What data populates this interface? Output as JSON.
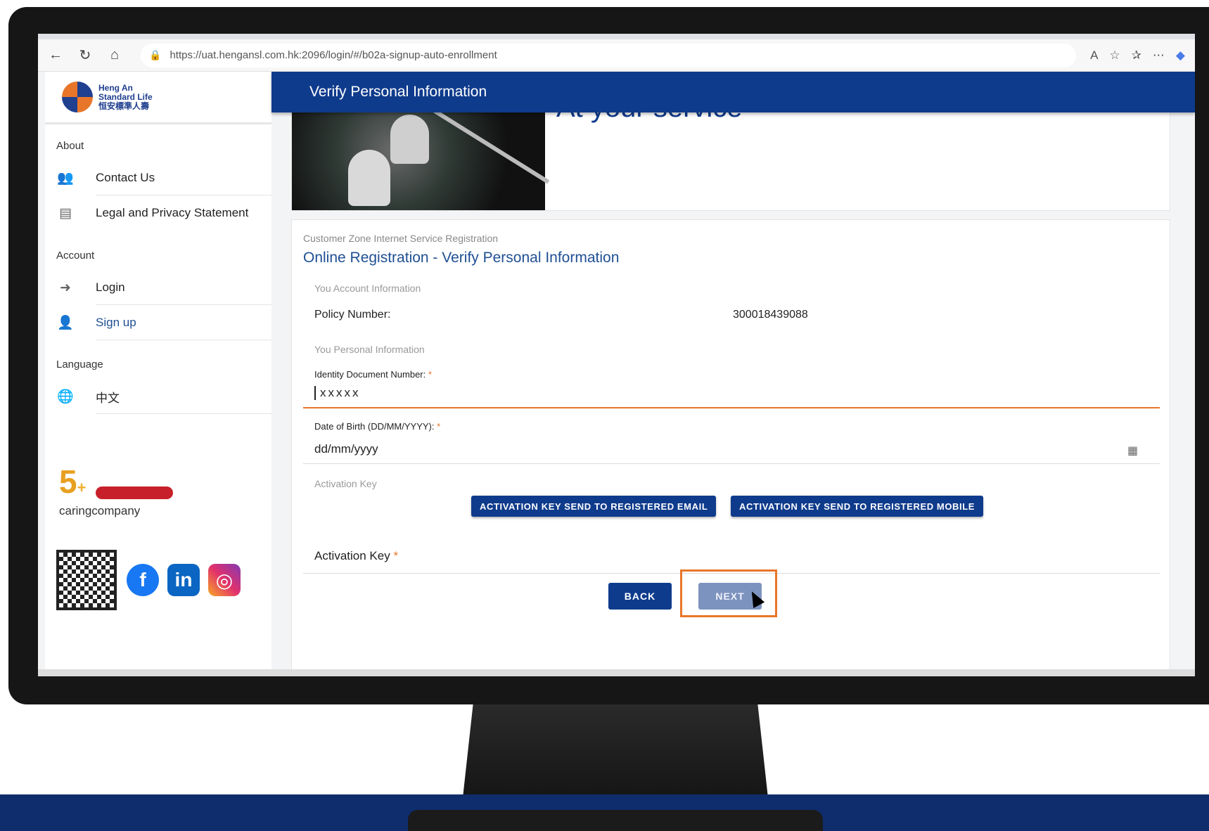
{
  "browser": {
    "url": "https://uat.hengansl.com.hk:2096/login/#/b02a-signup-auto-enrollment"
  },
  "sidebar": {
    "logo_text_line1": "Heng An",
    "logo_text_line2": "Standard Life",
    "logo_text_line3": "恒安標準人壽",
    "sections": {
      "about": "About",
      "account": "Account",
      "language": "Language"
    },
    "items": {
      "contact": "Contact Us",
      "legal": "Legal and Privacy Statement",
      "login": "Login",
      "signup": "Sign up",
      "chinese": "中文"
    },
    "caring_text": "caringcompany"
  },
  "header": {
    "title": "Verify Personal Information"
  },
  "banner": {
    "title": "At your service"
  },
  "form": {
    "breadcrumb": "Customer Zone Internet Service Registration",
    "title": "Online Registration - Verify Personal Information",
    "account_section": "You Account Information",
    "policy_label": "Policy Number:",
    "policy_value": "300018439088",
    "personal_section": "You Personal Information",
    "id_label": "Identity Document Number:",
    "id_value": "xxxxx",
    "dob_label": "Date of Birth (DD/MM/YYYY):",
    "dob_placeholder": "dd/mm/yyyy",
    "activation_section": "Activation Key",
    "email_btn": "ACTIVATION KEY SEND TO REGISTERED EMAIL",
    "mobile_btn": "ACTIVATION KEY SEND TO REGISTERED MOBILE",
    "activation_label": "Activation Key",
    "required_mark": "*",
    "back_btn": "BACK",
    "next_btn": "NEXT"
  },
  "colors": {
    "brand_blue": "#0f3b8c",
    "accent_orange": "#e8762a"
  }
}
